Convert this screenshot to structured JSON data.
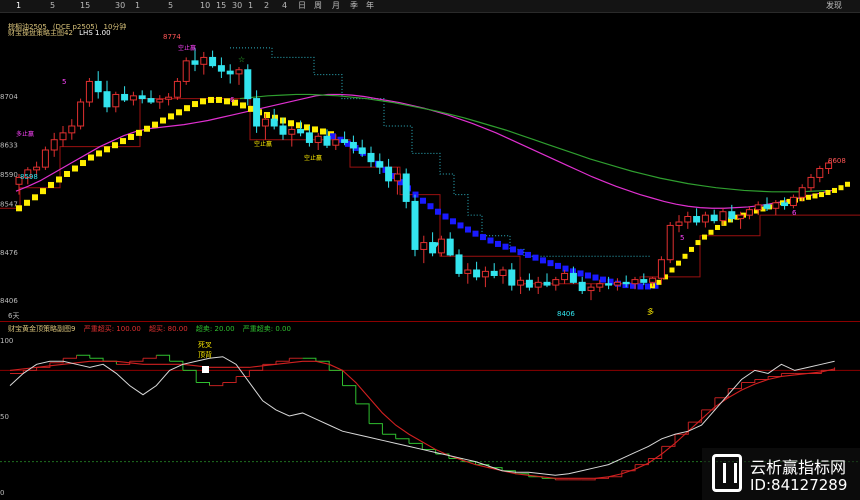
{
  "toolbar": {
    "items": [
      "1",
      "5",
      "15",
      "30",
      "1",
      "5",
      "10",
      "15",
      "30",
      "1",
      "2",
      "4",
      "日",
      "周",
      "月",
      "季",
      "年"
    ],
    "right_label": "发现"
  },
  "main_pane": {
    "header": {
      "title": "棕榈油2505",
      "exchange": "(DCE p2505)",
      "period": "10分钟",
      "indicator": "财宝操盘策略主图42",
      "lhs": "LHS 1.00"
    },
    "y_labels": [
      "8704",
      "8633",
      "8590",
      "8547",
      "8476",
      "8406"
    ],
    "annotations": {
      "high": "8774",
      "low": "8406",
      "last": "8608",
      "left_price": "8598",
      "buy_kong_1": "空止赢",
      "buy_kong_2": "空止赢",
      "buy_kong_3": "空止赢",
      "duo_ying": "多止赢",
      "duo": "多",
      "heart": "♥",
      "star": "☆",
      "num1": "5",
      "num2": "6",
      "num3": "5",
      "num4": "6"
    },
    "footer_label": "6天"
  },
  "sub_pane": {
    "header": {
      "name": "财宝黄金顶策略副图",
      "param": "9",
      "l1_label": "严重超买:",
      "l1_value": "100.00",
      "l2_label": "超买:",
      "l2_value": "80.00",
      "l3_label": "超卖:",
      "l3_value": "20.00",
      "l4_label": "严重超卖:",
      "l4_value": "0.00"
    },
    "y_labels": [
      "100",
      "50",
      "0"
    ],
    "signal_1": "死叉",
    "signal_2": "顶背"
  },
  "watermark": {
    "name": "云析赢指标网",
    "id": "ID:84127289"
  },
  "colors": {
    "up": "#e03030",
    "down": "#33e4ee",
    "yellow": "#ffee00",
    "blue": "#1a1aff",
    "green_line": "#2f9e2f",
    "magenta_line": "#e030d0",
    "dotted": "#2fb5c5",
    "stair": "#9a1010"
  },
  "chart_data": {
    "type": "candlestick",
    "ylim": [
      8380,
      8800
    ],
    "bars": [
      [
        8575,
        8590,
        8560,
        8585
      ],
      [
        8585,
        8600,
        8575,
        8596
      ],
      [
        8596,
        8608,
        8588,
        8600
      ],
      [
        8600,
        8630,
        8596,
        8625
      ],
      [
        8625,
        8650,
        8615,
        8640
      ],
      [
        8640,
        8660,
        8630,
        8650
      ],
      [
        8650,
        8670,
        8640,
        8660
      ],
      [
        8660,
        8700,
        8655,
        8695
      ],
      [
        8695,
        8730,
        8688,
        8725
      ],
      [
        8725,
        8740,
        8700,
        8710
      ],
      [
        8710,
        8726,
        8680,
        8688
      ],
      [
        8688,
        8710,
        8680,
        8706
      ],
      [
        8706,
        8718,
        8695,
        8698
      ],
      [
        8698,
        8710,
        8690,
        8704
      ],
      [
        8704,
        8712,
        8693,
        8700
      ],
      [
        8700,
        8712,
        8692,
        8695
      ],
      [
        8695,
        8705,
        8685,
        8699
      ],
      [
        8699,
        8708,
        8690,
        8702
      ],
      [
        8702,
        8730,
        8698,
        8725
      ],
      [
        8725,
        8760,
        8720,
        8755
      ],
      [
        8755,
        8774,
        8740,
        8750
      ],
      [
        8750,
        8768,
        8735,
        8760
      ],
      [
        8760,
        8770,
        8745,
        8748
      ],
      [
        8748,
        8760,
        8730,
        8740
      ],
      [
        8740,
        8750,
        8722,
        8736
      ],
      [
        8736,
        8746,
        8720,
        8742
      ],
      [
        8742,
        8750,
        8690,
        8700
      ],
      [
        8700,
        8712,
        8650,
        8660
      ],
      [
        8660,
        8678,
        8640,
        8670
      ],
      [
        8670,
        8685,
        8655,
        8660
      ],
      [
        8660,
        8672,
        8640,
        8648
      ],
      [
        8648,
        8660,
        8630,
        8655
      ],
      [
        8655,
        8668,
        8645,
        8650
      ],
      [
        8650,
        8660,
        8630,
        8636
      ],
      [
        8636,
        8650,
        8625,
        8645
      ],
      [
        8645,
        8655,
        8628,
        8632
      ],
      [
        8632,
        8648,
        8625,
        8640
      ],
      [
        8640,
        8652,
        8632,
        8636
      ],
      [
        8636,
        8646,
        8620,
        8628
      ],
      [
        8628,
        8640,
        8615,
        8620
      ],
      [
        8620,
        8630,
        8600,
        8608
      ],
      [
        8608,
        8620,
        8590,
        8600
      ],
      [
        8600,
        8612,
        8570,
        8580
      ],
      [
        8580,
        8600,
        8560,
        8590
      ],
      [
        8590,
        8598,
        8540,
        8550
      ],
      [
        8550,
        8560,
        8470,
        8480
      ],
      [
        8480,
        8500,
        8460,
        8490
      ],
      [
        8490,
        8505,
        8470,
        8475
      ],
      [
        8475,
        8500,
        8470,
        8495
      ],
      [
        8495,
        8505,
        8470,
        8472
      ],
      [
        8472,
        8480,
        8440,
        8445
      ],
      [
        8445,
        8460,
        8430,
        8450
      ],
      [
        8450,
        8462,
        8435,
        8440
      ],
      [
        8440,
        8455,
        8425,
        8448
      ],
      [
        8448,
        8460,
        8438,
        8442
      ],
      [
        8442,
        8455,
        8430,
        8450
      ],
      [
        8450,
        8460,
        8420,
        8428
      ],
      [
        8428,
        8440,
        8415,
        8435
      ],
      [
        8435,
        8445,
        8420,
        8425
      ],
      [
        8425,
        8440,
        8415,
        8432
      ],
      [
        8432,
        8445,
        8425,
        8428
      ],
      [
        8428,
        8440,
        8420,
        8436
      ],
      [
        8436,
        8450,
        8430,
        8445
      ],
      [
        8445,
        8455,
        8430,
        8432
      ],
      [
        8432,
        8440,
        8415,
        8420
      ],
      [
        8420,
        8430,
        8406,
        8425
      ],
      [
        8425,
        8436,
        8418,
        8430
      ],
      [
        8430,
        8440,
        8422,
        8428
      ],
      [
        8428,
        8438,
        8420,
        8432
      ],
      [
        8432,
        8442,
        8425,
        8430
      ],
      [
        8430,
        8440,
        8422,
        8436
      ],
      [
        8436,
        8445,
        8428,
        8432
      ],
      [
        8432,
        8440,
        8426,
        8438
      ],
      [
        8438,
        8470,
        8430,
        8465
      ],
      [
        8465,
        8520,
        8460,
        8515
      ],
      [
        8515,
        8530,
        8505,
        8520
      ],
      [
        8520,
        8535,
        8510,
        8528
      ],
      [
        8528,
        8540,
        8515,
        8520
      ],
      [
        8520,
        8535,
        8512,
        8530
      ],
      [
        8530,
        8538,
        8518,
        8522
      ],
      [
        8522,
        8540,
        8515,
        8535
      ],
      [
        8535,
        8545,
        8520,
        8525
      ],
      [
        8525,
        8535,
        8510,
        8530
      ],
      [
        8530,
        8542,
        8524,
        8538
      ],
      [
        8538,
        8550,
        8530,
        8545
      ],
      [
        8545,
        8556,
        8536,
        8540
      ],
      [
        8540,
        8552,
        8530,
        8548
      ],
      [
        8548,
        8556,
        8538,
        8544
      ],
      [
        8544,
        8560,
        8540,
        8556
      ],
      [
        8556,
        8575,
        8550,
        8570
      ],
      [
        8570,
        8590,
        8565,
        8585
      ],
      [
        8585,
        8602,
        8578,
        8598
      ],
      [
        8598,
        8610,
        8590,
        8606
      ]
    ],
    "ma_yellow": [
      8540,
      8548,
      8556,
      8565,
      8574,
      8582,
      8590,
      8598,
      8606,
      8614,
      8620,
      8626,
      8632,
      8638,
      8644,
      8650,
      8656,
      8662,
      8668,
      8674,
      8680,
      8686,
      8692,
      8696,
      8698,
      8698,
      8696,
      8694,
      8690,
      8685,
      8680,
      8676,
      8672,
      8668,
      8664,
      8661,
      8658,
      8655,
      8652,
      8648
    ],
    "ma_blue": [
      8645,
      8640,
      8634,
      8628,
      8621,
      8613,
      8605,
      8596,
      8587,
      8578,
      8569,
      8560,
      8551,
      8543,
      8535,
      8528,
      8521,
      8515,
      8509,
      8503,
      8498,
      8493,
      8488,
      8484,
      8480,
      8476,
      8472,
      8468,
      8464,
      8460,
      8456,
      8452,
      8448,
      8445,
      8442,
      8439,
      8436,
      8433,
      8430,
      8428,
      8427,
      8426,
      8426,
      8427
    ],
    "ma_yellow2": [
      8427,
      8432,
      8440,
      8450,
      8460,
      8470,
      8480,
      8490,
      8498,
      8505,
      8512,
      8518,
      8523,
      8527,
      8530,
      8533,
      8536,
      8539,
      8542,
      8545,
      8548,
      8550,
      8552,
      8554,
      8556,
      8558,
      8560,
      8563,
      8566,
      8570,
      8575
    ],
    "ma_green": [
      8700,
      8702,
      8704,
      8705,
      8706,
      8706,
      8705,
      8704,
      8702,
      8700,
      8697,
      8694,
      8690,
      8686,
      8682,
      8677,
      8672,
      8666,
      8660,
      8654,
      8647,
      8640,
      8633,
      8626,
      8619,
      8612,
      8606,
      8600,
      8594,
      8589,
      8584,
      8580,
      8576,
      8573,
      8570,
      8568,
      8566,
      8565,
      8564,
      8564,
      8564,
      8565,
      8566
    ],
    "ma_magenta": [
      8565,
      8572,
      8580,
      8590,
      8600,
      8610,
      8620,
      8630,
      8638,
      8646,
      8652,
      8656,
      8658,
      8660,
      8662,
      8665,
      8668,
      8672,
      8676,
      8680,
      8684,
      8688,
      8692,
      8696,
      8700,
      8704,
      8706,
      8706,
      8705,
      8703,
      8700,
      8697,
      8694,
      8690,
      8686,
      8681,
      8676,
      8670,
      8664,
      8657,
      8650,
      8642,
      8634,
      8626,
      8618,
      8610,
      8602,
      8594,
      8586,
      8579,
      8572,
      8566,
      8560,
      8555,
      8550,
      8546,
      8543,
      8541,
      8540,
      8540,
      8541,
      8542,
      8544,
      8547,
      8550,
      8554,
      8558,
      8562,
      8566
    ],
    "dotted_upper": [
      8774,
      8774,
      8774,
      8760,
      8760,
      8760,
      8735,
      8735,
      8700,
      8700,
      8700,
      8660,
      8660,
      8620,
      8620,
      8590,
      8560,
      8530,
      8500,
      8500,
      8480,
      8470,
      8470,
      8470,
      8470,
      8470,
      8470,
      8470,
      8470,
      8470
    ],
    "k_line": [
      78,
      80,
      82,
      85,
      88,
      90,
      88,
      86,
      84,
      86,
      88,
      90,
      86,
      80,
      72,
      70,
      72,
      76,
      80,
      84,
      86,
      88,
      88,
      86,
      80,
      70,
      58,
      45,
      38,
      35,
      32,
      28,
      25,
      22,
      20,
      18,
      16,
      14,
      12,
      10,
      9,
      8,
      8,
      8,
      9,
      10,
      14,
      18,
      22,
      30,
      38,
      46,
      54,
      62,
      68,
      72,
      74,
      76,
      78,
      78,
      78,
      80,
      82
    ],
    "d_line": [
      80,
      81,
      82,
      83,
      84,
      85,
      86,
      86,
      86,
      85,
      84,
      84,
      84,
      84,
      83,
      82,
      82,
      82,
      82,
      83,
      84,
      85,
      86,
      86,
      84,
      80,
      72,
      62,
      52,
      44,
      38,
      33,
      28,
      24,
      21,
      18,
      16,
      14,
      12,
      11,
      10,
      9,
      9,
      9,
      9,
      10,
      12,
      15,
      19,
      25,
      32,
      40,
      48,
      56,
      62,
      67,
      71,
      74,
      76,
      77,
      78,
      79,
      81
    ],
    "white_line": [
      70,
      78,
      84,
      86,
      86,
      84,
      82,
      84,
      78,
      70,
      64,
      70,
      80,
      84,
      86,
      88,
      89,
      84,
      72,
      60,
      54,
      50,
      52,
      48,
      44,
      40,
      38,
      36,
      34,
      32,
      30,
      28,
      26,
      24,
      22,
      20,
      17,
      14,
      13,
      13,
      12,
      11,
      12,
      14,
      16,
      18,
      22,
      26,
      30,
      35,
      38,
      40,
      44,
      54,
      64,
      74,
      80,
      78,
      84,
      80,
      82,
      84,
      86
    ]
  }
}
